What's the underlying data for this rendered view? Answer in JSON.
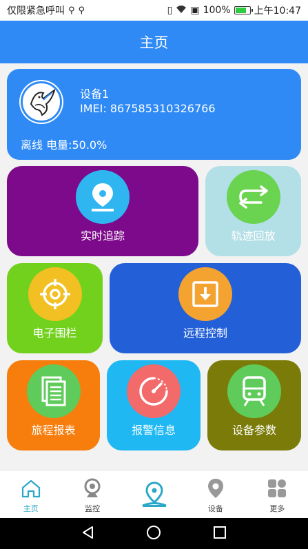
{
  "status_bar": {
    "carrier": "仅限紧急呼叫",
    "battery_percent": "100%",
    "time": "上午10:47"
  },
  "header": {
    "title": "主页"
  },
  "device": {
    "name": "设备1",
    "imei": "IMEI: 867585310326766",
    "status": "离线 电量:50.0%"
  },
  "tiles": {
    "realtime": {
      "label": "实时追踪",
      "bg": "#7d0a8a",
      "circle": "#2fb6f0"
    },
    "playback": {
      "label": "轨迹回放",
      "bg": "#b3dfe6",
      "circle": "#6ad34f"
    },
    "fence": {
      "label": "电子围栏",
      "bg": "#72d11c",
      "circle": "#f2c022"
    },
    "remote": {
      "label": "远程控制",
      "bg": "#2360d8",
      "circle": "#f4a230"
    },
    "report": {
      "label": "旅程报表",
      "bg": "#f77d0c",
      "circle": "#5ecb5a"
    },
    "alarm": {
      "label": "报警信息",
      "bg": "#1fb8f2",
      "circle": "#f26a6a"
    },
    "params": {
      "label": "设备参数",
      "bg": "#7a7b08",
      "circle": "#5ecb5a"
    }
  },
  "tabs": [
    {
      "label": "主页",
      "icon": "home-icon",
      "active": true
    },
    {
      "label": "监控",
      "icon": "camera-icon"
    },
    {
      "label": "",
      "icon": "location-icon"
    },
    {
      "label": "设备",
      "icon": "device-pin-icon"
    },
    {
      "label": "更多",
      "icon": "grid-icon"
    }
  ]
}
